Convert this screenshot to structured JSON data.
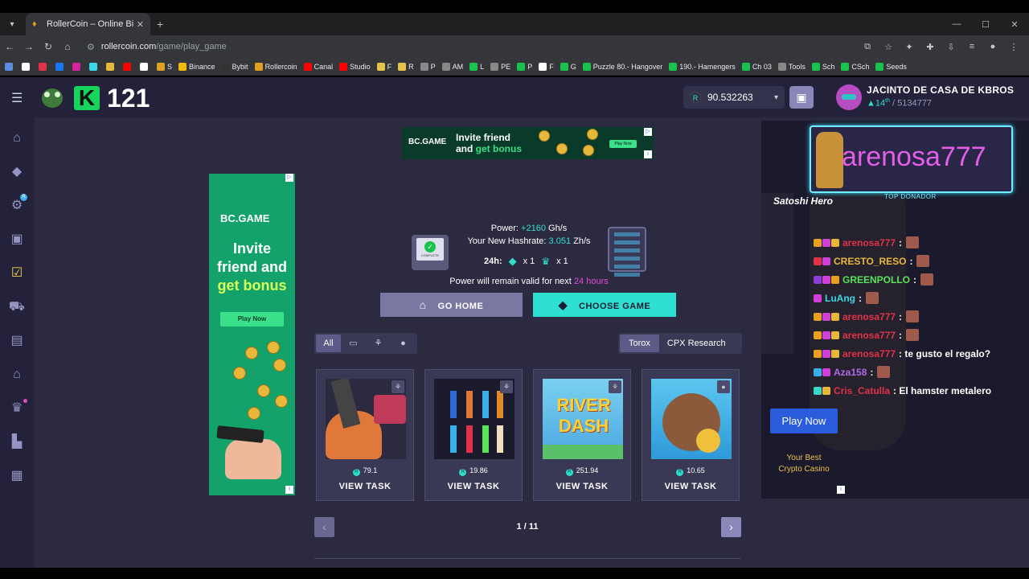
{
  "browser": {
    "tab_title": "RollerCoin – Online Bitcoin Mi",
    "url_host": "rollercoin.com",
    "url_path": "/game/play_game",
    "bookmarks": [
      {
        "label": "S",
        "color": "#e0a020"
      },
      {
        "label": "Binance",
        "color": "#f0b90b"
      },
      {
        "label": "Bybit",
        "color": "#333333"
      },
      {
        "label": "Rollercoin",
        "color": "#e0a020"
      },
      {
        "label": "Canal",
        "color": "#ff0000"
      },
      {
        "label": "Studio",
        "color": "#ff0000"
      },
      {
        "label": "F",
        "color": "#e8c34a"
      },
      {
        "label": "R",
        "color": "#e8c34a"
      },
      {
        "label": "P",
        "color": "#888888"
      },
      {
        "label": "AM",
        "color": "#888888"
      },
      {
        "label": "L",
        "color": "#19c24c"
      },
      {
        "label": "PE",
        "color": "#888888"
      },
      {
        "label": "P",
        "color": "#19c24c"
      },
      {
        "label": "F",
        "color": "#ffffff"
      },
      {
        "label": "G",
        "color": "#19c24c"
      },
      {
        "label": "Puzzle 80.- Hangover",
        "color": "#19c24c"
      },
      {
        "label": "190.- Hamengers",
        "color": "#19c24c"
      },
      {
        "label": "Ch 03",
        "color": "#19c24c"
      },
      {
        "label": "Tools",
        "color": "#888888"
      },
      {
        "label": "Sch",
        "color": "#19c24c"
      },
      {
        "label": "CSch",
        "color": "#19c24c"
      },
      {
        "label": "Seeds",
        "color": "#19c24c"
      }
    ]
  },
  "header": {
    "level": "121",
    "balance": "90.532263",
    "username": "JACINTO DE CASA DE KBROS",
    "rank": "14",
    "rank_suffix": "th",
    "rank_total": "/ 5134777"
  },
  "sidebar": {
    "items": [
      {
        "name": "home-icon",
        "glyph": "⌂"
      },
      {
        "name": "gamepad-icon",
        "glyph": "◆"
      },
      {
        "name": "rewards-icon",
        "glyph": "⚙"
      },
      {
        "name": "events-icon",
        "glyph": "▣"
      },
      {
        "name": "tasks-icon",
        "glyph": "☑"
      },
      {
        "name": "cart-icon",
        "glyph": "⛟"
      },
      {
        "name": "marketplace-icon",
        "glyph": "▤"
      },
      {
        "name": "store-icon",
        "glyph": "⌂"
      },
      {
        "name": "trophy-icon",
        "glyph": "♛"
      },
      {
        "name": "factory-icon",
        "glyph": "▙"
      },
      {
        "name": "news-icon",
        "glyph": "▦"
      }
    ],
    "badge_text": "R"
  },
  "ad_top": {
    "brand": "BC.GAME",
    "line1": "Invite friend",
    "line2_pre": "and ",
    "line2_hl": "get bonus",
    "play": "Play Now"
  },
  "ad_left": {
    "brand": "BC.GAME",
    "line1": "Invite",
    "line2": "friend and",
    "line3": "get bonus",
    "play": "Play Now"
  },
  "power": {
    "label": "Power:",
    "value": "+2160",
    "unit": "Gh/s",
    "hashrate_label": "Your New Hashrate:",
    "hashrate_value": "3.051",
    "hashrate_unit": "Zh/s",
    "h24": "24h:",
    "games_count": "x 1",
    "trophies_count": "x 1",
    "valid_text": "Power will remain valid for next",
    "valid_hours": "24 hours",
    "pc_label": "COMPLETE"
  },
  "buttons": {
    "go_home": "GO HOME",
    "choose_game": "CHOOSE GAME"
  },
  "filters": {
    "all": "All"
  },
  "providers": [
    "Torox",
    "CPX Research"
  ],
  "cards": [
    {
      "reward": "79.1",
      "action": "VIEW TASK",
      "platform": "android"
    },
    {
      "reward": "19.86",
      "action": "VIEW TASK",
      "platform": "android"
    },
    {
      "reward": "251.94",
      "action": "VIEW TASK",
      "platform": "android"
    },
    {
      "reward": "10.65",
      "action": "VIEW TASK",
      "platform": "apple"
    }
  ],
  "pager": {
    "text": "1 / 11"
  },
  "stream": {
    "donor_name": "arenosa777",
    "top_donor": "TOP DONADOR",
    "satoshi": "Satoshi Hero",
    "chat": [
      {
        "user": "arenosa777",
        "color": "#e0334a",
        "msg": ":",
        "emote": true
      },
      {
        "user": "CRESTO_RESO",
        "color": "#e8b83a",
        "msg": ":",
        "emote": true
      },
      {
        "user": "GREENPOLLO",
        "color": "#5ae45a",
        "msg": ":",
        "emote": true
      },
      {
        "user": "LuAng",
        "color": "#3ad8e8",
        "msg": ":",
        "emote": true
      },
      {
        "user": "arenosa777",
        "color": "#e0334a",
        "msg": ":",
        "emote": true
      },
      {
        "user": "arenosa777",
        "color": "#e0334a",
        "msg": ":",
        "emote": true
      },
      {
        "user": "arenosa777",
        "color": "#e0334a",
        "msg": ": te gusto el regalo?",
        "emote": false
      },
      {
        "user": "Aza158",
        "color": "#b26ae8",
        "msg": ":",
        "emote": true
      },
      {
        "user": "Cris_Catulla",
        "color": "#e0334a",
        "msg": ": El hamster metalero",
        "emote": false
      }
    ],
    "play_now": "Play Now",
    "best1": "Your Best",
    "best2": "Crypto Casino"
  }
}
